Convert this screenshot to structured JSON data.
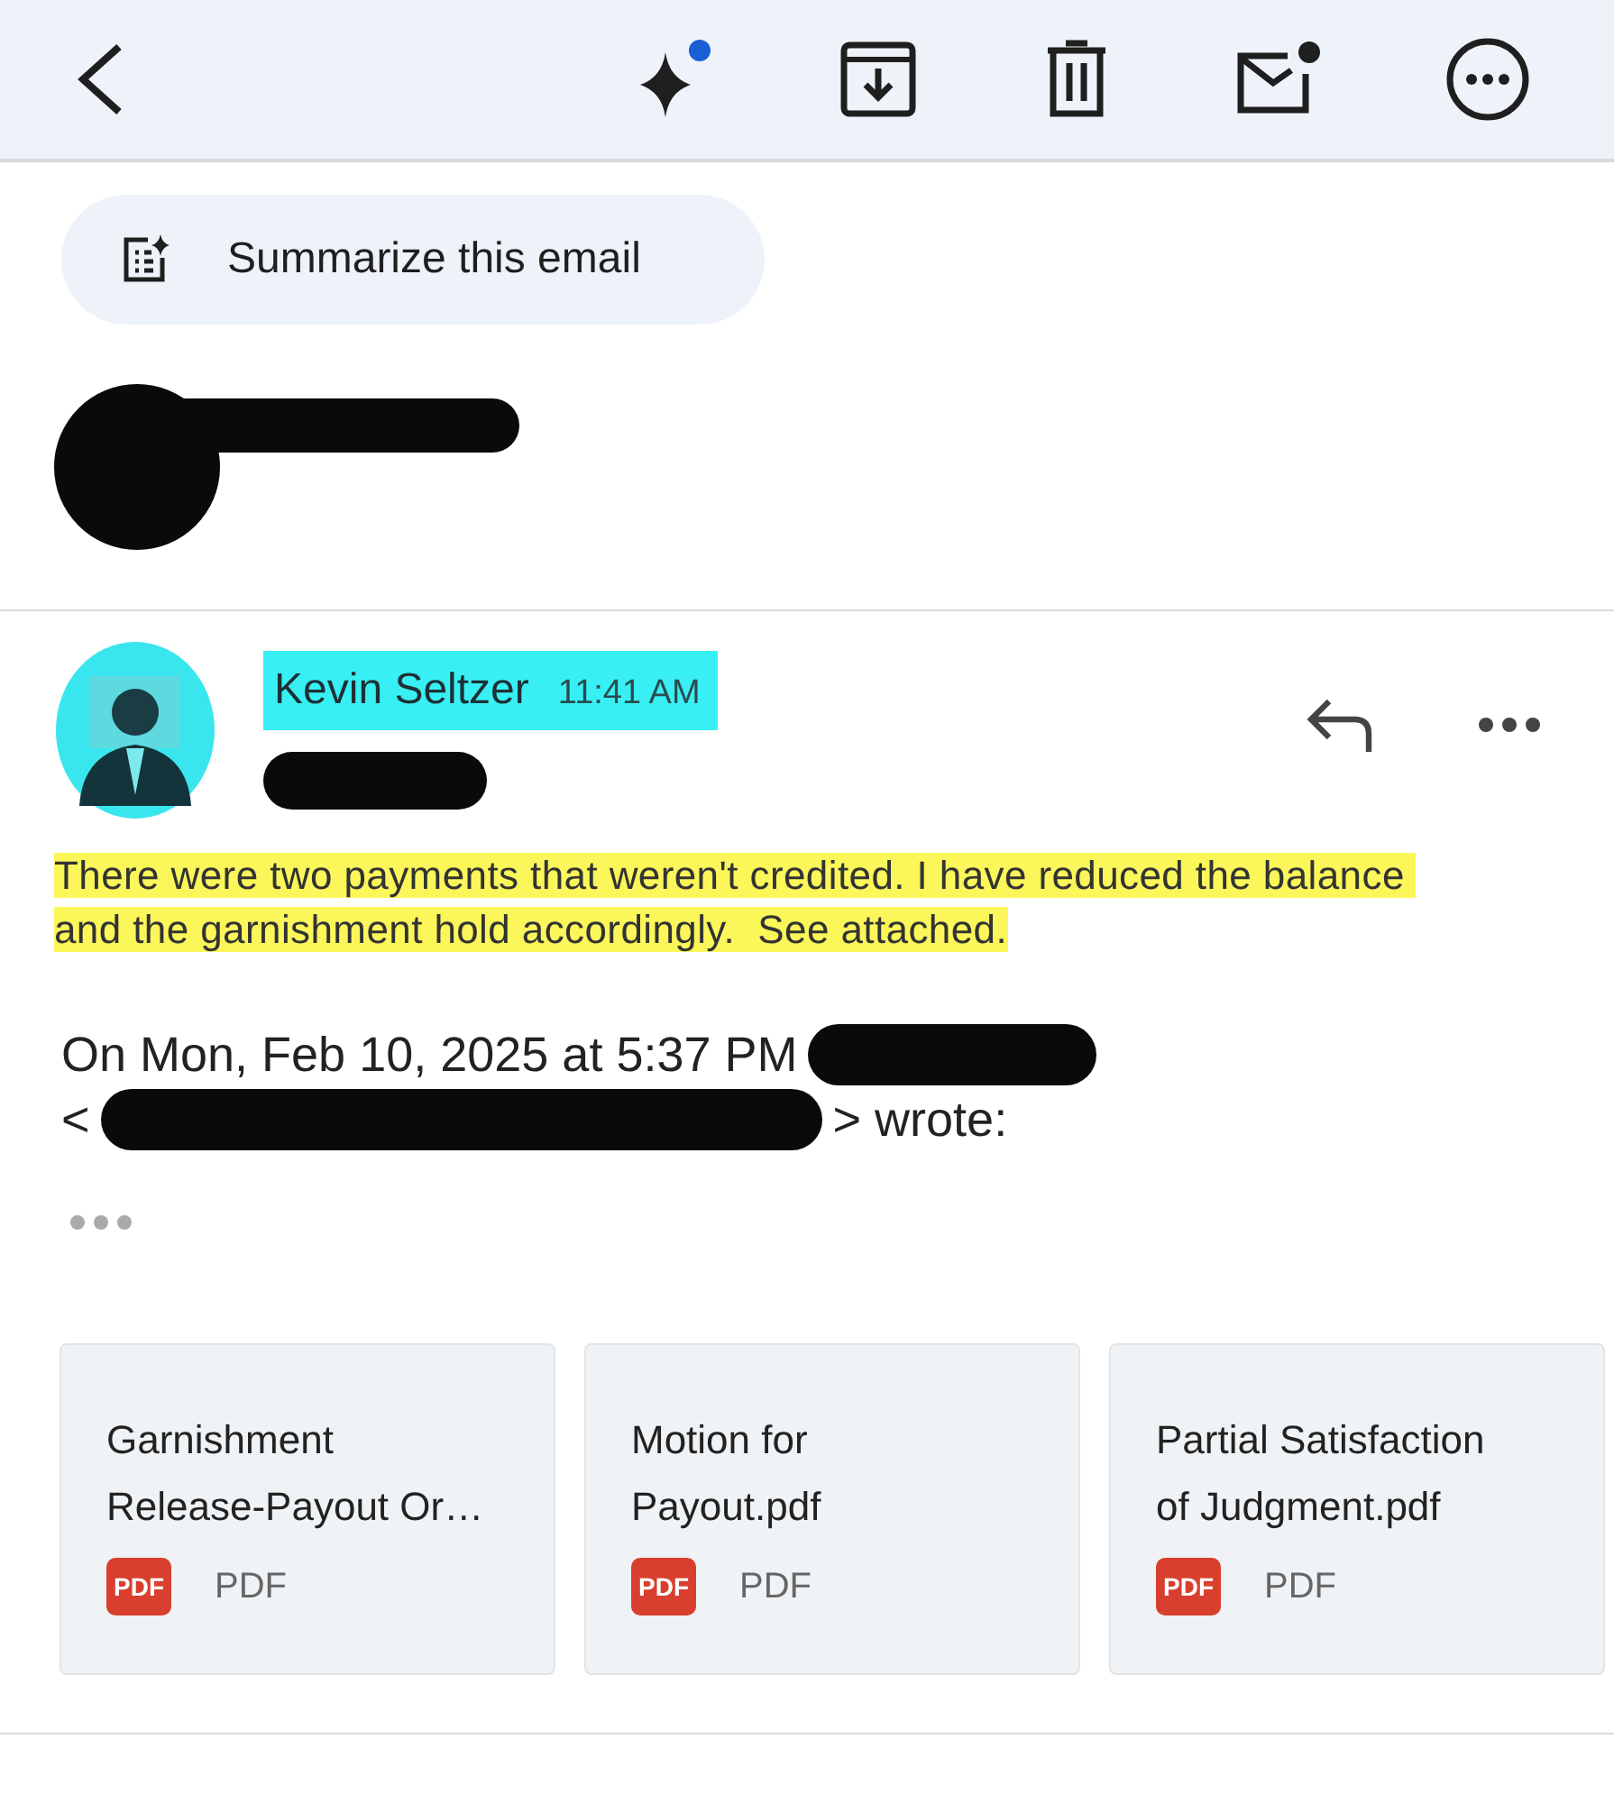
{
  "summary_button": {
    "label": "Summarize this email"
  },
  "message": {
    "sender": "Kevin Seltzer",
    "time": "11:41 AM",
    "body": "There were two payments that weren't credited. I have reduced the balance and the garnishment hold accordingly.  See attached.",
    "quote_header": "On Mon, Feb 10, 2025 at 5:37 PM",
    "quote_open": "<",
    "quote_end": "> wrote:"
  },
  "attachments": [
    {
      "name_lines": [
        "Garnishment",
        "Release-Payout Or…"
      ],
      "icon_label": "PDF",
      "type": "PDF"
    },
    {
      "name_lines": [
        "Motion for",
        "Payout.pdf"
      ],
      "icon_label": "PDF",
      "type": "PDF"
    },
    {
      "name_lines": [
        "Partial Satisfaction",
        "of Judgment.pdf"
      ],
      "icon_label": "PDF",
      "type": "PDF"
    }
  ]
}
